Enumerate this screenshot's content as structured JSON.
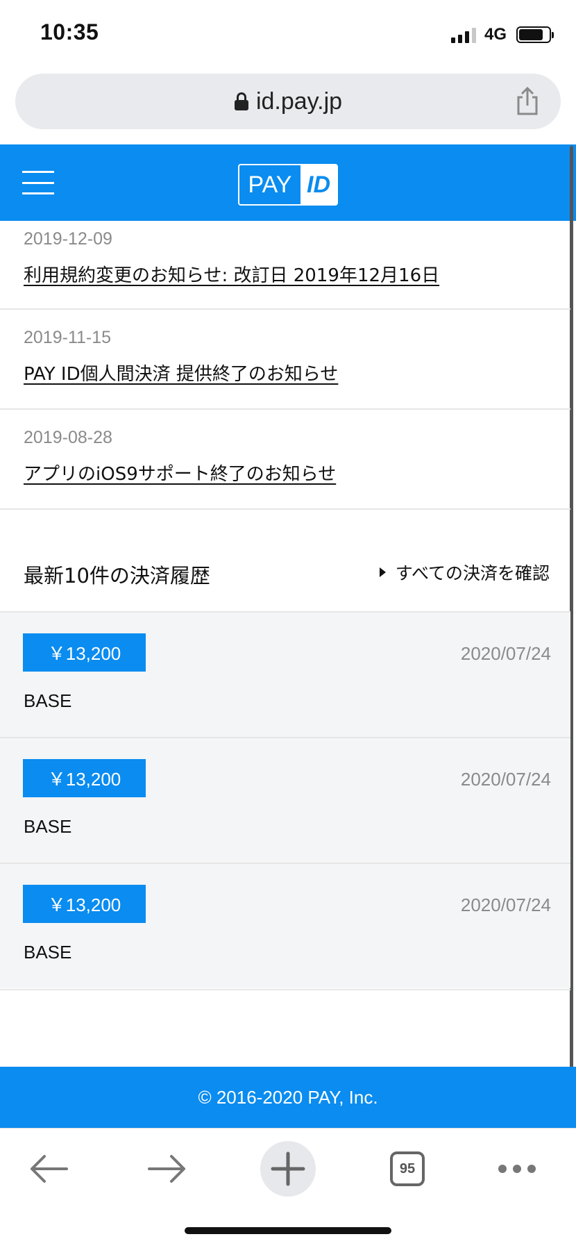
{
  "status_bar": {
    "time": "10:35",
    "network": "4G"
  },
  "browser": {
    "url": "id.pay.jp",
    "tab_count": "95"
  },
  "header": {
    "logo_left": "PAY",
    "logo_right": "ID"
  },
  "news": [
    {
      "date": "2019-12-09",
      "title": "利用規約変更のお知らせ: 改訂日 2019年12月16日"
    },
    {
      "date": "2019-11-15",
      "title": "PAY ID個人間決済 提供終了のお知らせ"
    },
    {
      "date": "2019-08-28",
      "title": "アプリのiOS9サポート終了のお知らせ"
    }
  ],
  "payments_section": {
    "title": "最新10件の決済履歴",
    "view_all_label": "すべての決済を確認"
  },
  "payments": [
    {
      "amount": "￥13,200",
      "date": "2020/07/24",
      "merchant": "BASE"
    },
    {
      "amount": "￥13,200",
      "date": "2020/07/24",
      "merchant": "BASE"
    },
    {
      "amount": "￥13,200",
      "date": "2020/07/24",
      "merchant": "BASE"
    }
  ],
  "footer": {
    "copyright": "© 2016-2020 PAY, Inc."
  },
  "colors": {
    "brand_blue": "#0a8cf0",
    "row_background": "#f4f5f6",
    "muted_text": "#8a8a8a"
  }
}
